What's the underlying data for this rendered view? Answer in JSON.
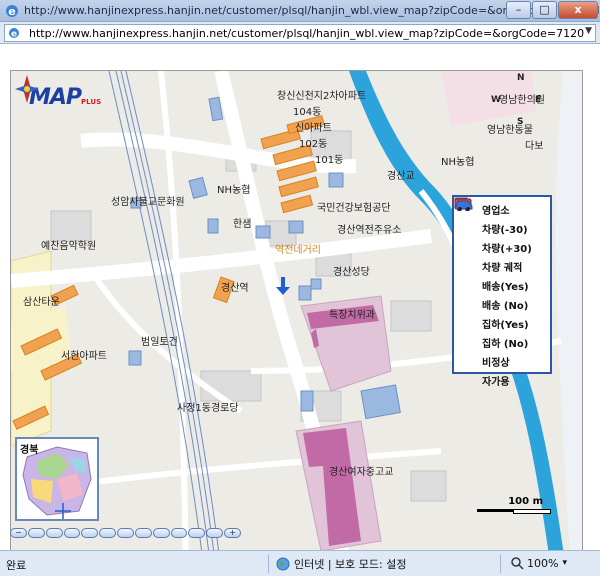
{
  "window": {
    "title": "http://www.hanjinexpress.hanjin.net/customer/plsql/hanjin_wbl.view_map?zipCode=&orgCode=7120 - Micr...",
    "url": "http://www.hanjinexpress.hanjin.net/customer/plsql/hanjin_wbl.view_map?zipCode=&orgCode=7120",
    "minimize": "–",
    "maximize": "□",
    "close": "x"
  },
  "map": {
    "logo_main": "MAP",
    "logo_sub": "PLUS",
    "compass": {
      "n": "N",
      "s": "S",
      "e": "E",
      "w": "W"
    },
    "labels": [
      "창신신천지2차아파트",
      "104동",
      "신아파트",
      "102동",
      "101동",
      "영남한의원",
      "영남한동물",
      "다보",
      "NH농협",
      "경산교",
      "성암사불교문화원",
      "NH농협",
      "국민건강보험공단",
      "한샘",
      "경산역전주유소",
      "예찬음악학원",
      "역전네거리",
      "경산성당",
      "삼산타운",
      "경산역",
      "범일토건",
      "특장치위과",
      "서한아파트",
      "사정1동경로당",
      "경산여자중고교"
    ],
    "legend": [
      {
        "label": "영업소",
        "icon": "branch-office-icon"
      },
      {
        "label": "차량(-30)",
        "icon": "vehicle-minus30-icon"
      },
      {
        "label": "차량(+30)",
        "icon": "vehicle-plus30-icon"
      },
      {
        "label": "차량 궤적",
        "icon": "vehicle-track-icon"
      },
      {
        "label": "배송(Yes)",
        "icon": "delivery-yes-icon"
      },
      {
        "label": "배송 (No)",
        "icon": "delivery-no-icon"
      },
      {
        "label": "집하(Yes)",
        "icon": "pickup-yes-icon"
      },
      {
        "label": "집하 (No)",
        "icon": "pickup-no-icon"
      },
      {
        "label": "비정상",
        "icon": "abnormal-icon"
      },
      {
        "label": "자가용",
        "icon": "private-car-icon"
      }
    ],
    "minimap_title": "경북",
    "scale_label": "100 m",
    "zoom_steps": [
      "−",
      "",
      "",
      "",
      "",
      "",
      "",
      "",
      "",
      "",
      "",
      "",
      "+"
    ]
  },
  "status": {
    "left": "완료",
    "zone": "인터넷 | 보호 모드: 설정",
    "zoom": "100%",
    "zoom_arrow": "▾"
  }
}
